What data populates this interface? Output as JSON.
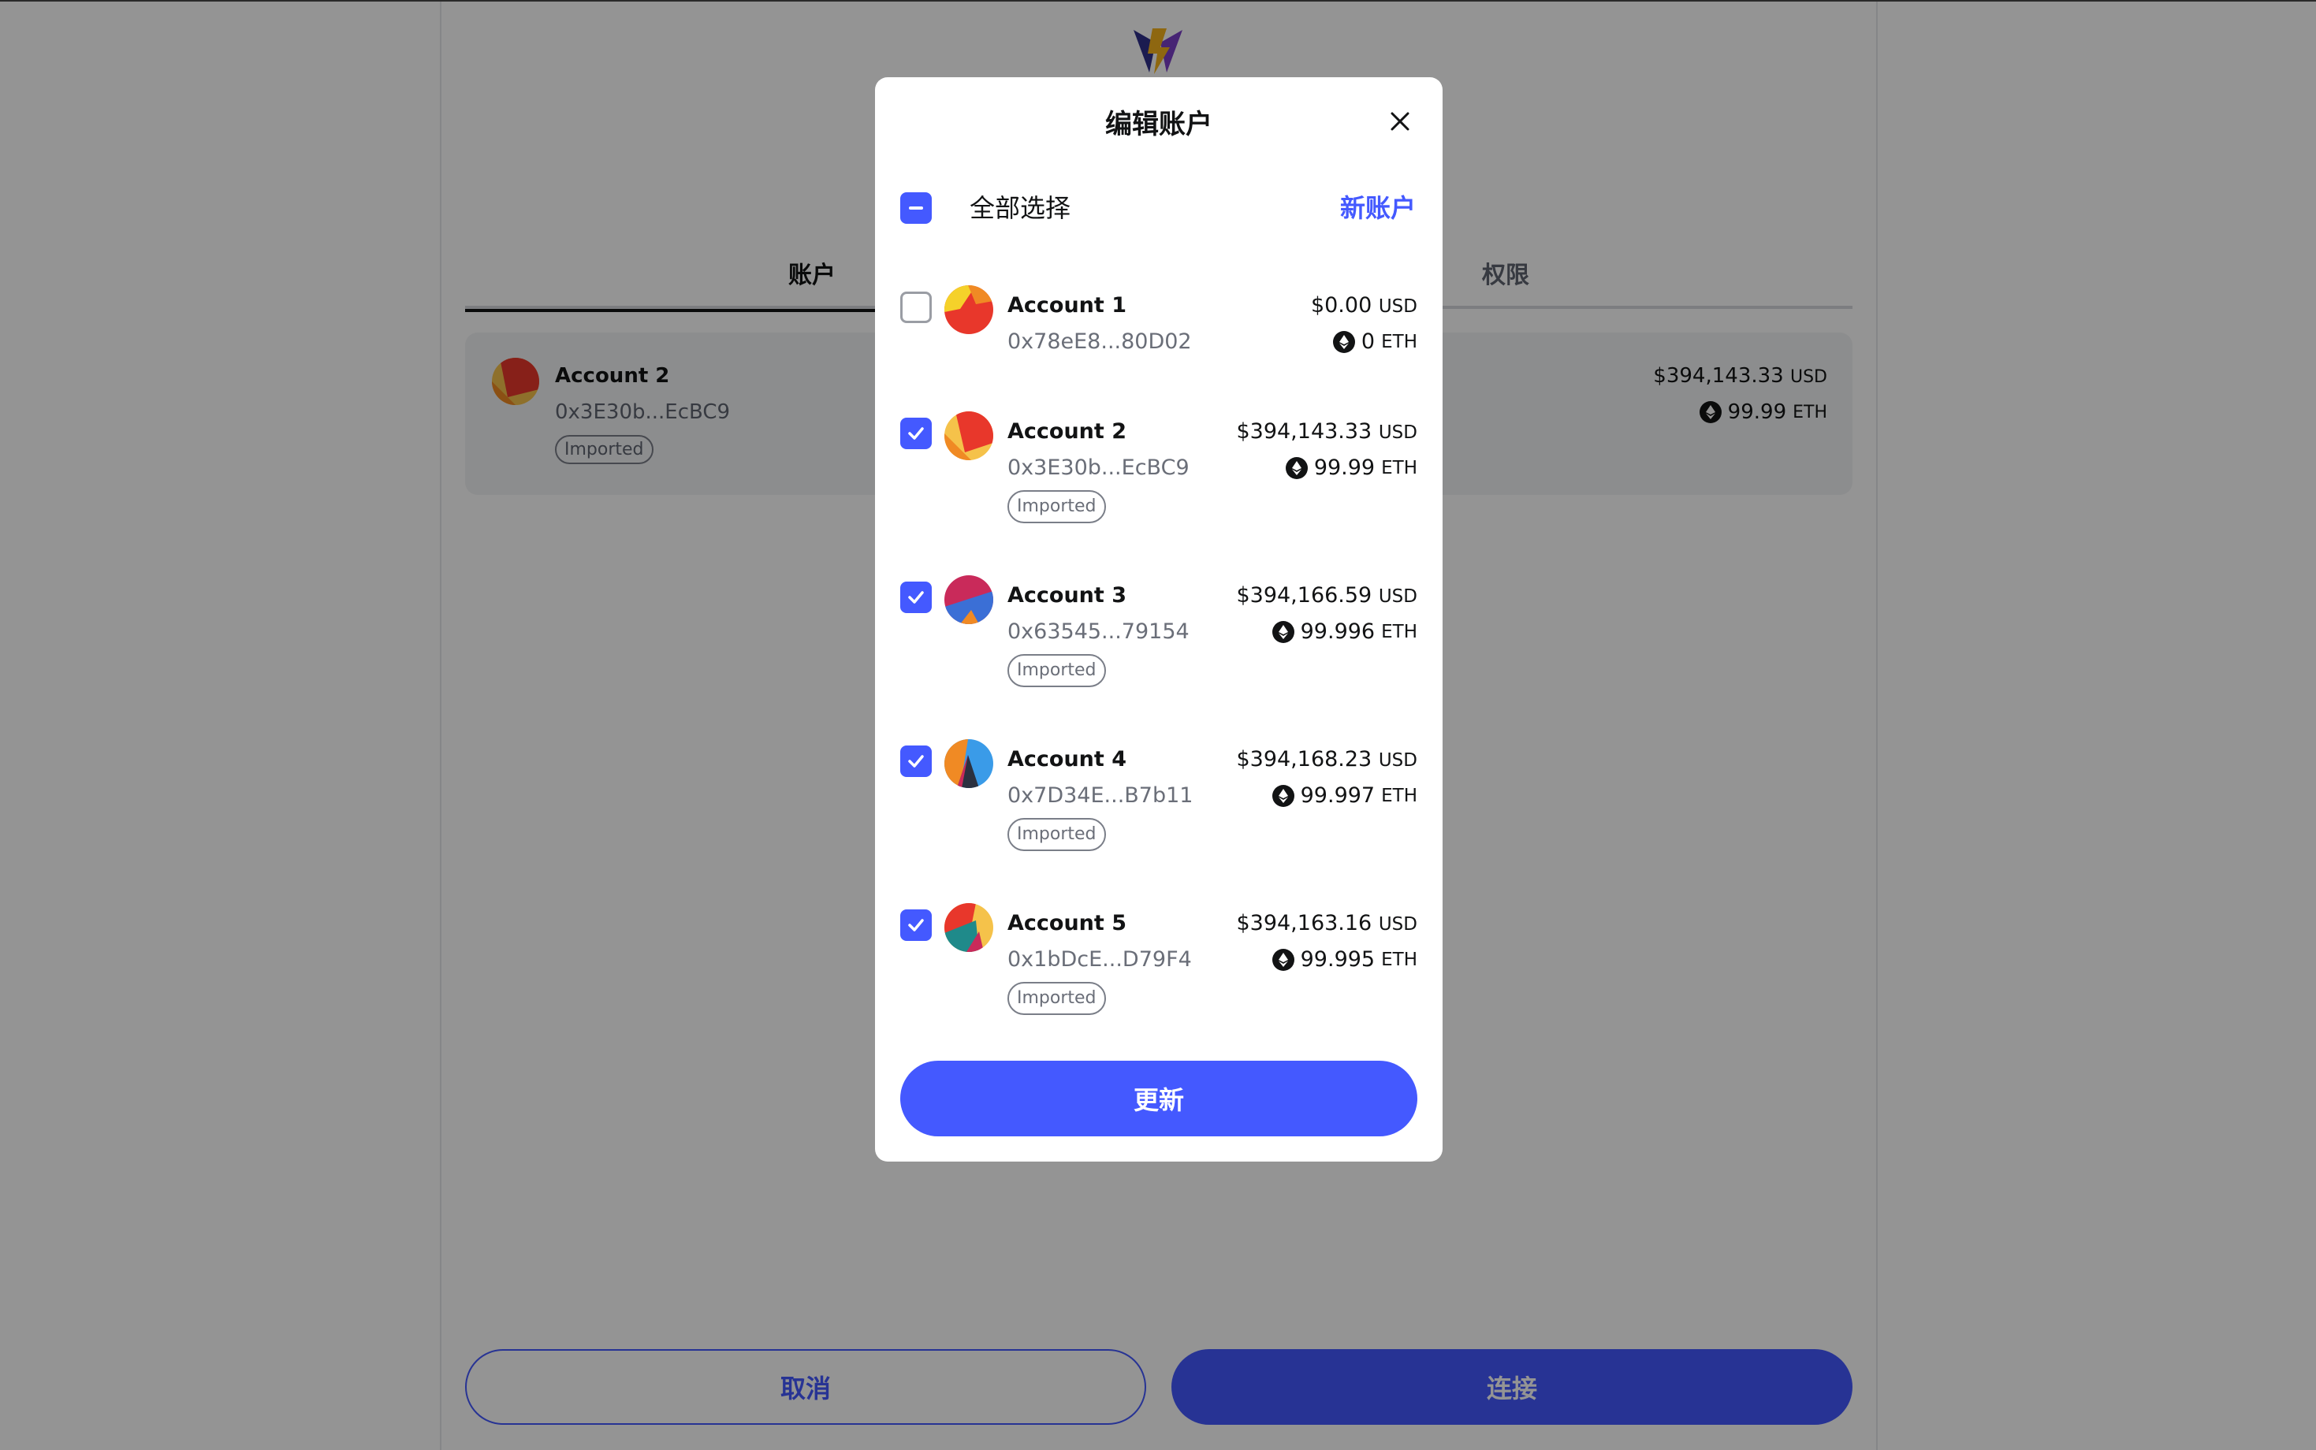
{
  "background": {
    "tabs": [
      {
        "label": "账户"
      },
      {
        "label": "权限"
      }
    ],
    "selected_account": {
      "name": "Account 2",
      "address": "0x3E30b...EcBC9",
      "badge": "Imported",
      "usd_value": "$394,143.33",
      "usd_unit": "USD",
      "eth_value": "99.99",
      "eth_unit": "ETH"
    },
    "cancel_label": "取消",
    "connect_label": "连接"
  },
  "modal": {
    "title": "编辑账户",
    "select_all_label": "全部选择",
    "new_account_label": "新账户",
    "update_label": "更新",
    "accounts": [
      {
        "name": "Account 1",
        "address": "0x78eE8...80D02",
        "badge": "",
        "usd_value": "$0.00",
        "usd_unit": "USD",
        "eth_value": "0",
        "eth_unit": "ETH",
        "checked": false
      },
      {
        "name": "Account 2",
        "address": "0x3E30b...EcBC9",
        "badge": "Imported",
        "usd_value": "$394,143.33",
        "usd_unit": "USD",
        "eth_value": "99.99",
        "eth_unit": "ETH",
        "checked": true
      },
      {
        "name": "Account 3",
        "address": "0x63545...79154",
        "badge": "Imported",
        "usd_value": "$394,166.59",
        "usd_unit": "USD",
        "eth_value": "99.996",
        "eth_unit": "ETH",
        "checked": true
      },
      {
        "name": "Account 4",
        "address": "0x7D34E...B7b11",
        "badge": "Imported",
        "usd_value": "$394,168.23",
        "usd_unit": "USD",
        "eth_value": "99.997",
        "eth_unit": "ETH",
        "checked": true
      },
      {
        "name": "Account 5",
        "address": "0x1bDcE...D79F4",
        "badge": "Imported",
        "usd_value": "$394,163.16",
        "usd_unit": "USD",
        "eth_value": "99.995",
        "eth_unit": "ETH",
        "checked": true
      }
    ]
  },
  "colors": {
    "accent": "#4459ff",
    "overlay": "rgba(0,0,0,0.42)"
  },
  "icons": [
    "metamask-fox-icon",
    "close-icon",
    "checkbox-check-icon",
    "checkbox-partial-icon",
    "eth-icon",
    "account-avatar-icon"
  ]
}
